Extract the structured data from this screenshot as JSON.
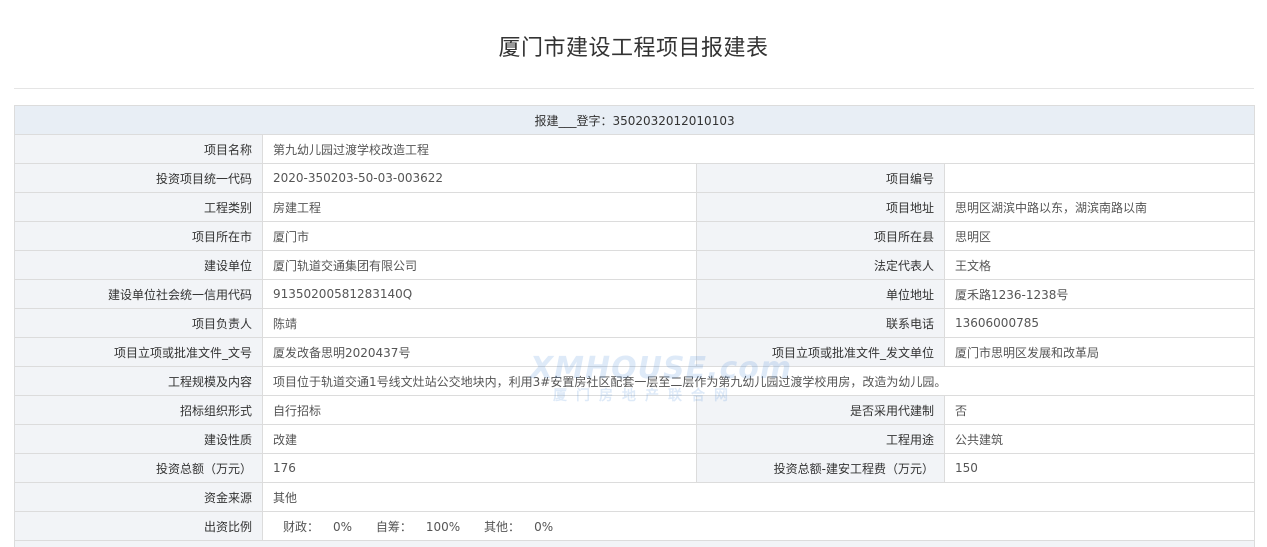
{
  "page": {
    "title": "厦门市建设工程项目报建表"
  },
  "table": {
    "registration": "报建___登字：3502032012010103",
    "project_name_label": "项目名称",
    "project_name_value": "第九幼儿园过渡学校改造工程",
    "invest_code_label": "投资项目统一代码",
    "invest_code_value": "2020-350203-50-03-003622",
    "project_no_label": "项目编号",
    "project_no_value": "",
    "project_type_label": "工程类别",
    "project_type_value": "房建工程",
    "project_address_label": "项目地址",
    "project_address_value": "思明区湖滨中路以东，湖滨南路以南",
    "city_label": "项目所在市",
    "city_value": "厦门市",
    "county_label": "项目所在县",
    "county_value": "思明区",
    "builder_label": "建设单位",
    "builder_value": "厦门轨道交通集团有限公司",
    "legal_rep_label": "法定代表人",
    "legal_rep_value": "王文格",
    "credit_code_label": "建设单位社会统一信用代码",
    "credit_code_value": "91350200581283140Q",
    "unit_address_label": "单位地址",
    "unit_address_value": "厦禾路1236-1238号",
    "manager_label": "项目负责人",
    "manager_value": "陈靖",
    "phone_label": "联系电话",
    "phone_value": "13606000785",
    "approval_no_label": "项目立项或批准文件_文号",
    "approval_no_value": "厦发改备思明2020437号",
    "approval_unit_label": "项目立项或批准文件_发文单位",
    "approval_unit_value": "厦门市思明区发展和改革局",
    "scale_label": "工程规模及内容",
    "scale_value": "项目位于轨道交通1号线文灶站公交地块内，利用3#安置房社区配套一层至二层作为第九幼儿园过渡学校用房，改造为幼儿园。",
    "bidding_label": "招标组织形式",
    "bidding_value": "自行招标",
    "agent_label": "是否采用代建制",
    "agent_value": "否",
    "nature_label": "建设性质",
    "nature_value": "改建",
    "usage_label": "工程用途",
    "usage_value": "公共建筑",
    "total_invest_label": "投资总额（万元）",
    "total_invest_value": "176",
    "construction_cost_label": "投资总额-建安工程费（万元）",
    "construction_cost_value": "150",
    "fund_source_label": "资金来源",
    "fund_source_value": "其他",
    "ratio_label": "出资比例",
    "ratio_items": [
      {
        "label": "财政：",
        "value": "0%"
      },
      {
        "label": "自筹：",
        "value": "100%"
      },
      {
        "label": "其他：",
        "value": "0%"
      }
    ]
  },
  "watermark": {
    "en": "XMHOUSE.com",
    "cn": "厦门房地产联合网"
  },
  "colors": {
    "label_bg": "#f2f4f7",
    "header_bg": "#e8eef5",
    "border": "#dcdcdc",
    "watermark": "#1d6fd1"
  }
}
